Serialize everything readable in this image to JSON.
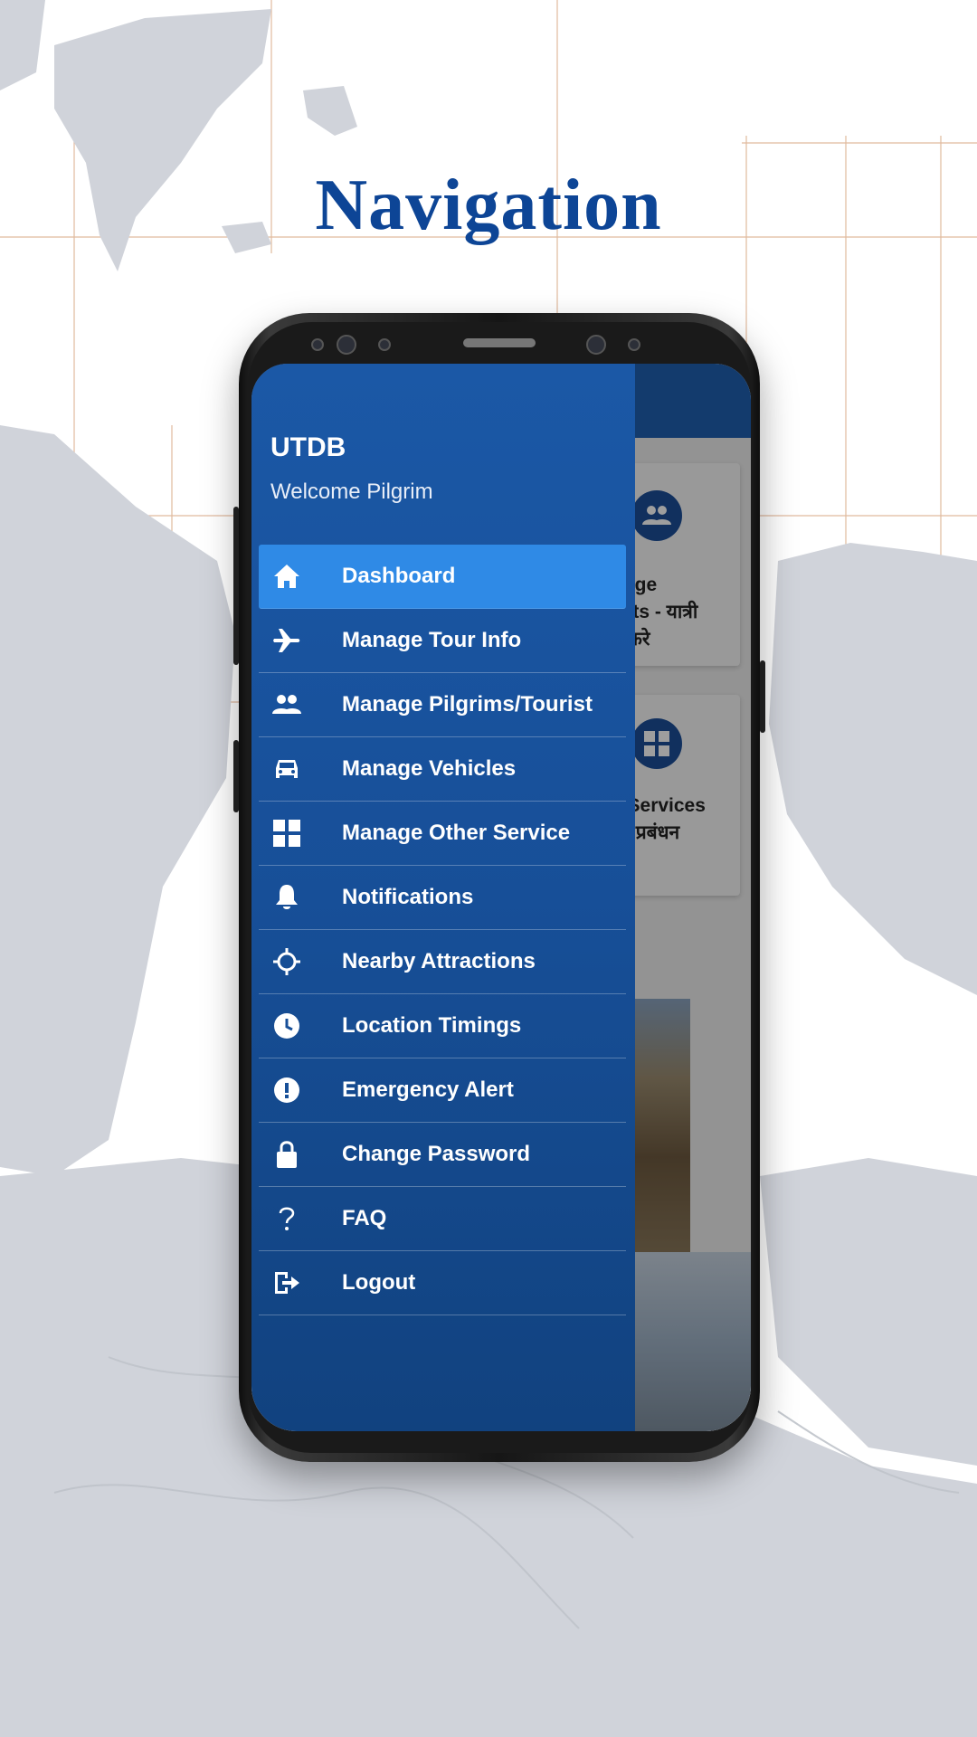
{
  "headline": "Navigation",
  "drawer": {
    "brand": "UTDB",
    "welcome": "Welcome Pilgrim",
    "items": [
      {
        "label": "Dashboard",
        "icon": "home-icon",
        "active": true
      },
      {
        "label": "Manage Tour Info",
        "icon": "airplane-icon"
      },
      {
        "label": "Manage Pilgrims/Tourist",
        "icon": "people-icon"
      },
      {
        "label": "Manage Vehicles",
        "icon": "car-icon"
      },
      {
        "label": "Manage Other Service",
        "icon": "grid-icon"
      },
      {
        "label": "Notifications",
        "icon": "bell-icon"
      },
      {
        "label": "Nearby Attractions",
        "icon": "crosshair-icon"
      },
      {
        "label": "Location Timings",
        "icon": "clock-icon"
      },
      {
        "label": "Emergency Alert",
        "icon": "alert-icon"
      },
      {
        "label": "Change Password",
        "icon": "lock-icon"
      },
      {
        "label": "FAQ",
        "icon": "question-icon"
      },
      {
        "label": "Logout",
        "icon": "logout-icon"
      }
    ]
  },
  "background_app": {
    "card1": {
      "text": "Manage\nourists - यात्री\nकरण करे",
      "icon": "people-icon"
    },
    "card2": {
      "text": "ther Services\nओं का प्रबंधन\nकरे",
      "icon": "grid-icon"
    }
  },
  "colors": {
    "headline": "#0d4596",
    "drawer": "#174f98",
    "active_item": "#2f8ae6"
  }
}
